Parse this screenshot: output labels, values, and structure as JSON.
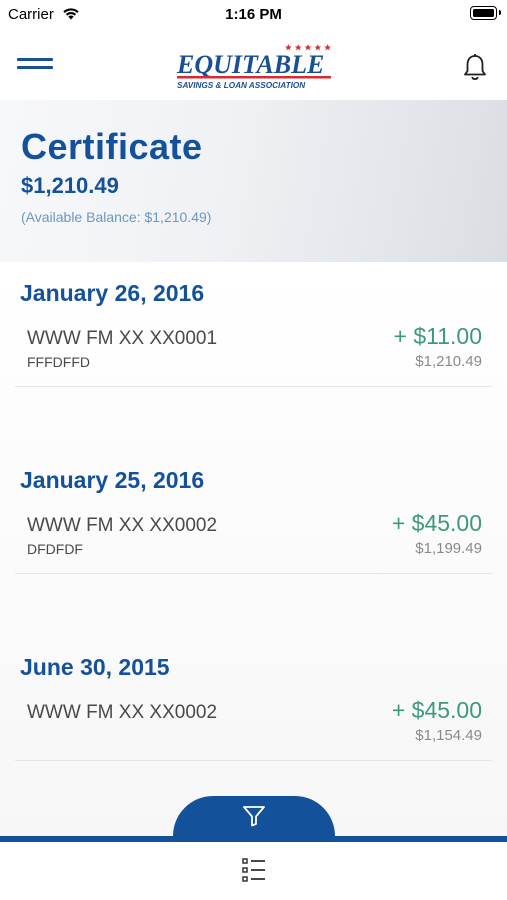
{
  "status_bar": {
    "carrier": "Carrier",
    "time": "1:16 PM"
  },
  "navbar": {
    "logo": {
      "name": "EQUITABLE",
      "tagline": "SAVINGS & LOAN ASSOCIATION"
    },
    "menu_icon": "hamburger-menu-icon",
    "bell_icon": "bell-icon"
  },
  "account": {
    "name": "Certificate",
    "balance": "$1,210.49",
    "available": "(Available Balance: $1,210.49)"
  },
  "transactions": [
    {
      "date": "January 26, 2016",
      "description": "WWW FM XX XX0001",
      "memo": "FFFDFFD",
      "amount": "+ $11.00",
      "running_balance": "$1,210.49"
    },
    {
      "date": "January 25, 2016",
      "description": "WWW FM XX XX0002",
      "memo": "DFDFDF",
      "amount": "+ $45.00",
      "running_balance": "$1,199.49"
    },
    {
      "date": "June 30, 2015",
      "description": "WWW FM XX XX0002",
      "memo": "",
      "amount": "+ $45.00",
      "running_balance": "$1,154.49"
    }
  ],
  "bottom": {
    "filter_icon": "filter-icon",
    "list_icon": "list-view-icon"
  },
  "colors": {
    "brand_blue": "#13519b",
    "credit_green": "#3d9a76",
    "logo_red": "#d62b32"
  }
}
